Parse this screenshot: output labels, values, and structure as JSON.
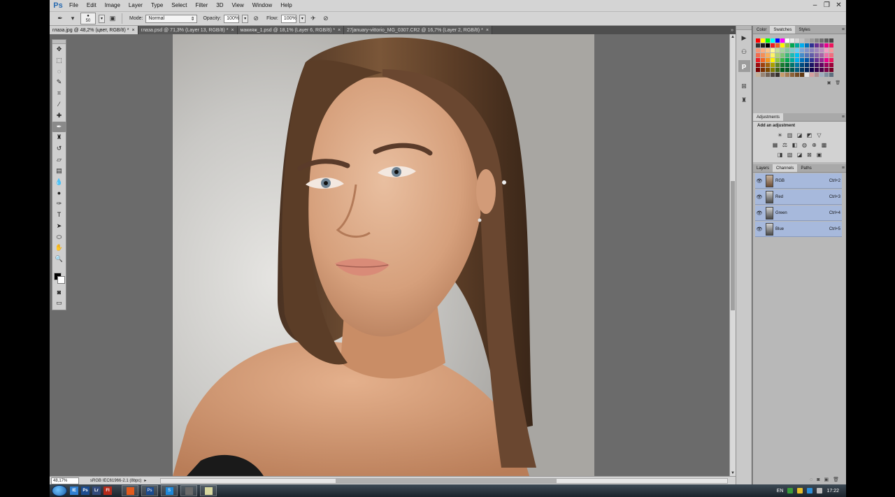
{
  "app": {
    "logo": "Ps"
  },
  "menu": [
    "File",
    "Edit",
    "Image",
    "Layer",
    "Type",
    "Select",
    "Filter",
    "3D",
    "View",
    "Window",
    "Help"
  ],
  "window_controls": [
    "–",
    "❐",
    "✕"
  ],
  "options": {
    "brush_size": "50",
    "mode_label": "Mode:",
    "mode_value": "Normal",
    "opacity_label": "Opacity:",
    "opacity_value": "100%",
    "flow_label": "Flow:",
    "flow_value": "100%"
  },
  "tabs": [
    {
      "label": "глаза.jpg @ 48,2% (цвет, RGB/8) *",
      "active": true
    },
    {
      "label": "глаза.psd @ 71,3% (Layer 13, RGB/8) *",
      "active": false
    },
    {
      "label": "макияж_1.psd @ 18,1% (Layer 6, RGB/8) *",
      "active": false
    },
    {
      "label": "27january-vittorio_MG_0307.CR2 @ 16,7% (Layer 2, RGB/8) *",
      "active": false
    }
  ],
  "tabs_overflow": "»",
  "tools": [
    {
      "name": "move-tool",
      "icon": "move-icon",
      "glyph": "✥"
    },
    {
      "name": "marquee-tool",
      "icon": "marquee-icon",
      "glyph": "⬚"
    },
    {
      "name": "lasso-tool",
      "icon": "lasso-icon",
      "glyph": "◌"
    },
    {
      "name": "quick-select-tool",
      "icon": "quick-select-icon",
      "glyph": "✎"
    },
    {
      "name": "crop-tool",
      "icon": "crop-icon",
      "glyph": "⌗"
    },
    {
      "name": "eyedropper-tool",
      "icon": "eyedropper-icon",
      "glyph": "⁄"
    },
    {
      "name": "healing-brush-tool",
      "icon": "bandage-icon",
      "glyph": "✚"
    },
    {
      "name": "brush-tool",
      "icon": "brush-icon",
      "glyph": "✒"
    },
    {
      "name": "clone-stamp-tool",
      "icon": "stamp-icon",
      "glyph": "♜"
    },
    {
      "name": "history-brush-tool",
      "icon": "history-brush-icon",
      "glyph": "↺"
    },
    {
      "name": "eraser-tool",
      "icon": "eraser-icon",
      "glyph": "▱"
    },
    {
      "name": "gradient-tool",
      "icon": "gradient-icon",
      "glyph": "▤"
    },
    {
      "name": "blur-tool",
      "icon": "blur-icon",
      "glyph": "💧"
    },
    {
      "name": "dodge-tool",
      "icon": "dodge-icon",
      "glyph": "●"
    },
    {
      "name": "pen-tool",
      "icon": "pen-icon",
      "glyph": "✑"
    },
    {
      "name": "type-tool",
      "icon": "type-icon",
      "glyph": "T"
    },
    {
      "name": "path-select-tool",
      "icon": "path-select-icon",
      "glyph": "➤"
    },
    {
      "name": "shape-tool",
      "icon": "ellipse-icon",
      "glyph": "⬭"
    },
    {
      "name": "hand-tool",
      "icon": "hand-icon",
      "glyph": "✋"
    },
    {
      "name": "zoom-tool",
      "icon": "zoom-icon",
      "glyph": "🔍"
    }
  ],
  "tools_after_swatch": [
    {
      "name": "quick-mask-button",
      "icon": "quick-mask-icon",
      "glyph": "◙"
    },
    {
      "name": "screen-mode-button",
      "icon": "screen-mode-icon",
      "glyph": "▭"
    }
  ],
  "status": {
    "zoom": "48,17%",
    "profile": "sRGB IEC61966-2.1 (8bpc)",
    "arrow": "▸"
  },
  "panels": {
    "color_tabs": [
      "Color",
      "Swatches",
      "Styles"
    ],
    "color_active": 1,
    "adjustments_tab": "Adjustments",
    "adjustments_title": "Add an adjustment",
    "layer_tabs": [
      "Layers",
      "Channels",
      "Paths"
    ],
    "layer_active": 1
  },
  "channels": [
    {
      "name": "RGB",
      "shortcut": "Ctrl+2",
      "thumb": "color"
    },
    {
      "name": "Red",
      "shortcut": "Ctrl+3",
      "thumb": "gray"
    },
    {
      "name": "Green",
      "shortcut": "Ctrl+4",
      "thumb": "gray"
    },
    {
      "name": "Blue",
      "shortcut": "Ctrl+5",
      "thumb": "gray"
    }
  ],
  "swatch_colors": [
    [
      "#ff0000",
      "#ffff00",
      "#00ff00",
      "#00ffff",
      "#0000ff",
      "#ff00ff",
      "#ffffff",
      "#ebebeb",
      "#d6d6d6",
      "#c2c2c2",
      "#adadad",
      "#999999",
      "#858585",
      "#707070",
      "#5c5c5c",
      "#474747"
    ],
    [
      "#333333",
      "#1f1f1f",
      "#000000",
      "#ed1c24",
      "#f26522",
      "#fff200",
      "#8dc63f",
      "#00a651",
      "#00a99d",
      "#00aeef",
      "#0072bc",
      "#2e3192",
      "#662d91",
      "#92278f",
      "#ec008c",
      "#ed145b"
    ],
    [
      "#f7977a",
      "#fbad82",
      "#fdc68c",
      "#fff799",
      "#c6df9c",
      "#a4d49d",
      "#81ca9d",
      "#7bcdc9",
      "#6ccff7",
      "#7ca6d8",
      "#8293ca",
      "#8881be",
      "#a286bd",
      "#bc8cbf",
      "#f49bc1",
      "#f5999d"
    ],
    [
      "#f26c4f",
      "#f68e56",
      "#fbaf5a",
      "#fff467",
      "#acd372",
      "#7cc576",
      "#3bb878",
      "#1abbb4",
      "#00bff3",
      "#438ccb",
      "#5574b9",
      "#605ca9",
      "#855fa8",
      "#a763a9",
      "#ef6ea8",
      "#f16d7e"
    ],
    [
      "#ed1c24",
      "#f26522",
      "#f7941d",
      "#fff200",
      "#8dc63f",
      "#39b54a",
      "#00a651",
      "#00a99d",
      "#00aeef",
      "#0072bc",
      "#0054a5",
      "#2e3192",
      "#662d91",
      "#92278f",
      "#ec008c",
      "#ed145b"
    ],
    [
      "#9e0b0f",
      "#a0410d",
      "#a3620a",
      "#aba000",
      "#598527",
      "#197b30",
      "#007236",
      "#00746b",
      "#0076a3",
      "#004b80",
      "#003471",
      "#1b1464",
      "#440e62",
      "#630460",
      "#9e005d",
      "#9e0039"
    ],
    [
      "#790000",
      "#7b2e00",
      "#7d4900",
      "#827b00",
      "#406618",
      "#005e20",
      "#005826",
      "#005952",
      "#005b7f",
      "#003663",
      "#002157",
      "#0d004c",
      "#32004b",
      "#4b0049",
      "#7b0046",
      "#7a0026"
    ],
    [
      "#c7b299",
      "#998675",
      "#736357",
      "#534741",
      "#37302d",
      "#c69c6d",
      "#a67c52",
      "#8c6239",
      "#754c24",
      "#603913",
      "#e6e6e6",
      "#d4a0a0",
      "#b09090",
      "#a0b0c0",
      "#8090a0",
      "#607080"
    ]
  ],
  "adjustment_icons": [
    [
      "brightness-icon",
      "levels-icon",
      "curves-icon",
      "exposure-icon",
      "vibrance-icon"
    ],
    [
      "hue-sat-icon",
      "color-balance-icon",
      "bw-icon",
      "photo-filter-icon",
      "channel-mixer-icon",
      "color-lookup-icon"
    ],
    [
      "invert-icon",
      "posterize-icon",
      "threshold-icon",
      "selective-color-icon",
      "gradient-map-icon"
    ]
  ],
  "adjustment_glyphs": [
    [
      "☀",
      "▥",
      "◪",
      "◩",
      "▽"
    ],
    [
      "▦",
      "⚖",
      "◧",
      "◍",
      "⊕",
      "▩"
    ],
    [
      "◨",
      "▧",
      "◪",
      "⊠",
      "▣"
    ]
  ],
  "taskbar": {
    "apps": [
      "IE",
      "Ps",
      "Lr",
      "Fl"
    ],
    "windows": [
      "",
      "Ps",
      "S",
      "",
      ""
    ],
    "lang": "EN",
    "clock": "17:22"
  }
}
